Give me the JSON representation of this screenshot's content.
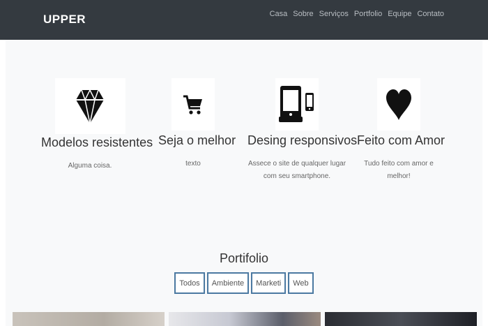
{
  "nav": {
    "brand": "UPPER",
    "links": [
      "Casa",
      "Sobre",
      "Serviços",
      "Portfolio",
      "Equipe",
      "Contato"
    ]
  },
  "features": [
    {
      "icon": "diamond-icon",
      "title": "Modelos resistentes",
      "text_lines": [
        "Alguma coisa."
      ]
    },
    {
      "icon": "cart-icon",
      "title": "Seja o melhor",
      "text_lines": [
        "texto"
      ]
    },
    {
      "icon": "devices-icon",
      "title": "Desing responsivos",
      "text_lines": [
        "Assece o site de qualquer lugar",
        "com seu smartphone."
      ]
    },
    {
      "icon": "heart-icon",
      "title": "Feito com Amor",
      "text_lines": [
        "Tudo feito com amor e melhor!"
      ]
    }
  ],
  "portfolio": {
    "title": "Portifolio",
    "filters": [
      "Todos",
      "Ambiente",
      "Marketi",
      "Web"
    ]
  },
  "colors": {
    "navbar": "#343a40",
    "content_bg": "#f8f9fa",
    "filter_border": "#4b79a1"
  }
}
